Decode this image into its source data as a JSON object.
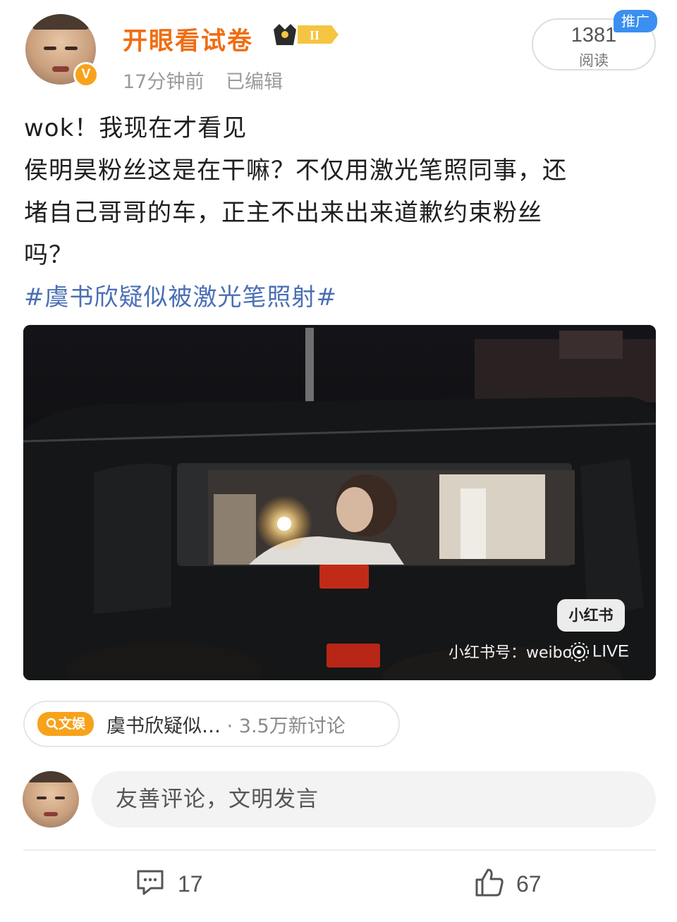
{
  "post": {
    "username": "开眼看试卷",
    "verified_badge": "V",
    "level_badge": "II",
    "time": "17分钟前",
    "edited": "已编辑",
    "read_count": "1381",
    "read_label": "阅读",
    "promo_tag": "推广",
    "text_lines": [
      "wok！我现在才看见",
      "侯明昊粉丝这是在干嘛？不仅用激光笔照同事，还",
      "堵自己哥哥的车，正主不出来出来道歉约束粉丝",
      "吗？"
    ],
    "hashtag": "#虞书欣疑似被激光笔照射#"
  },
  "media": {
    "watermark_logo": "小红书",
    "watermark_text": "小红书号：weibo",
    "live_label": "LIVE",
    "icon": "live-photo-icon"
  },
  "topic": {
    "tag_icon": "search-icon",
    "tag_label": "文娱",
    "title": "虞书欣疑似…",
    "separator": "·",
    "discussion": "3.5万新讨论"
  },
  "comment": {
    "placeholder": "友善评论，文明发言"
  },
  "actions": {
    "comment_count": "17",
    "like_count": "67",
    "comment_icon": "comment-icon",
    "like_icon": "thumbs-up-icon"
  },
  "colors": {
    "username": "#f06d11",
    "hashtag": "#4a6fb5",
    "verified": "#f7a21b",
    "promo": "#3a8ff0"
  }
}
